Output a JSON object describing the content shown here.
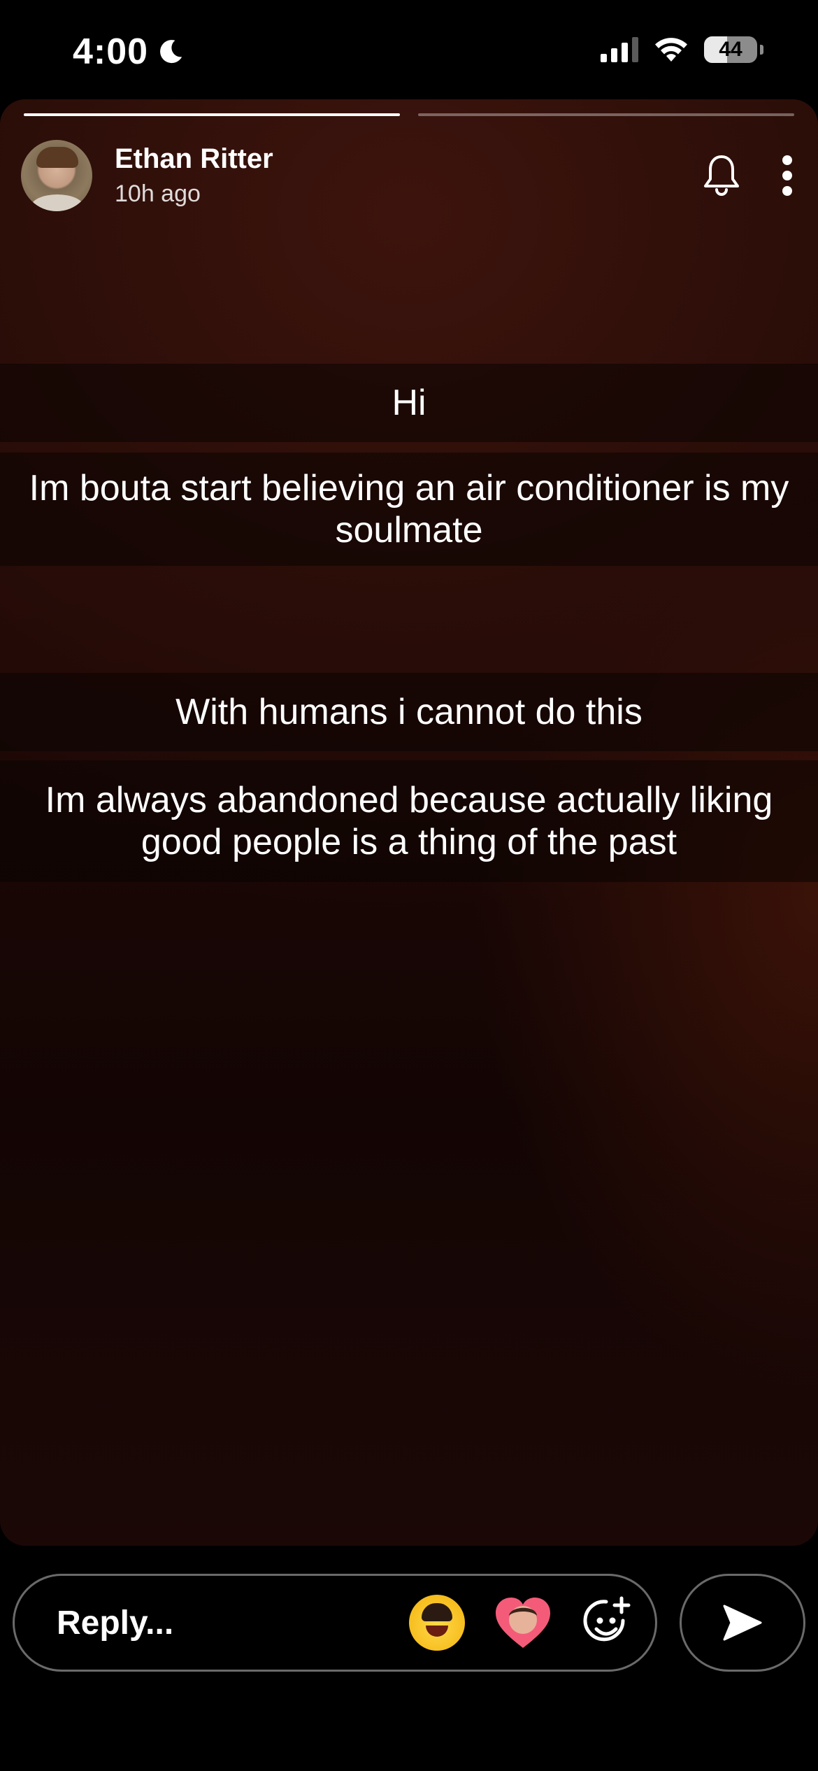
{
  "status_bar": {
    "time": "4:00",
    "battery": "44",
    "battery_level": 0.44,
    "signal_bars_active": 3,
    "signal_bars_total": 4
  },
  "story": {
    "progress": [
      1.0,
      0.0
    ],
    "user": {
      "name": "Ethan Ritter",
      "posted": "10h ago"
    },
    "captions": [
      "Hi",
      "Im bouta start believing an air conditioner is my soulmate",
      "With humans i cannot do this",
      "Im always abandoned because actually liking good people is a thing of the past"
    ]
  },
  "reply": {
    "placeholder": "Reply..."
  },
  "icons": {
    "moon": "moon-icon",
    "bell": "bell-icon",
    "more": "more-vertical-icon",
    "sticker": "sticker-add-icon",
    "send": "send-arrow-icon"
  },
  "colors": {
    "background": "#000000",
    "story_tint": "#2b0e09",
    "border": "#6a6a6a"
  }
}
